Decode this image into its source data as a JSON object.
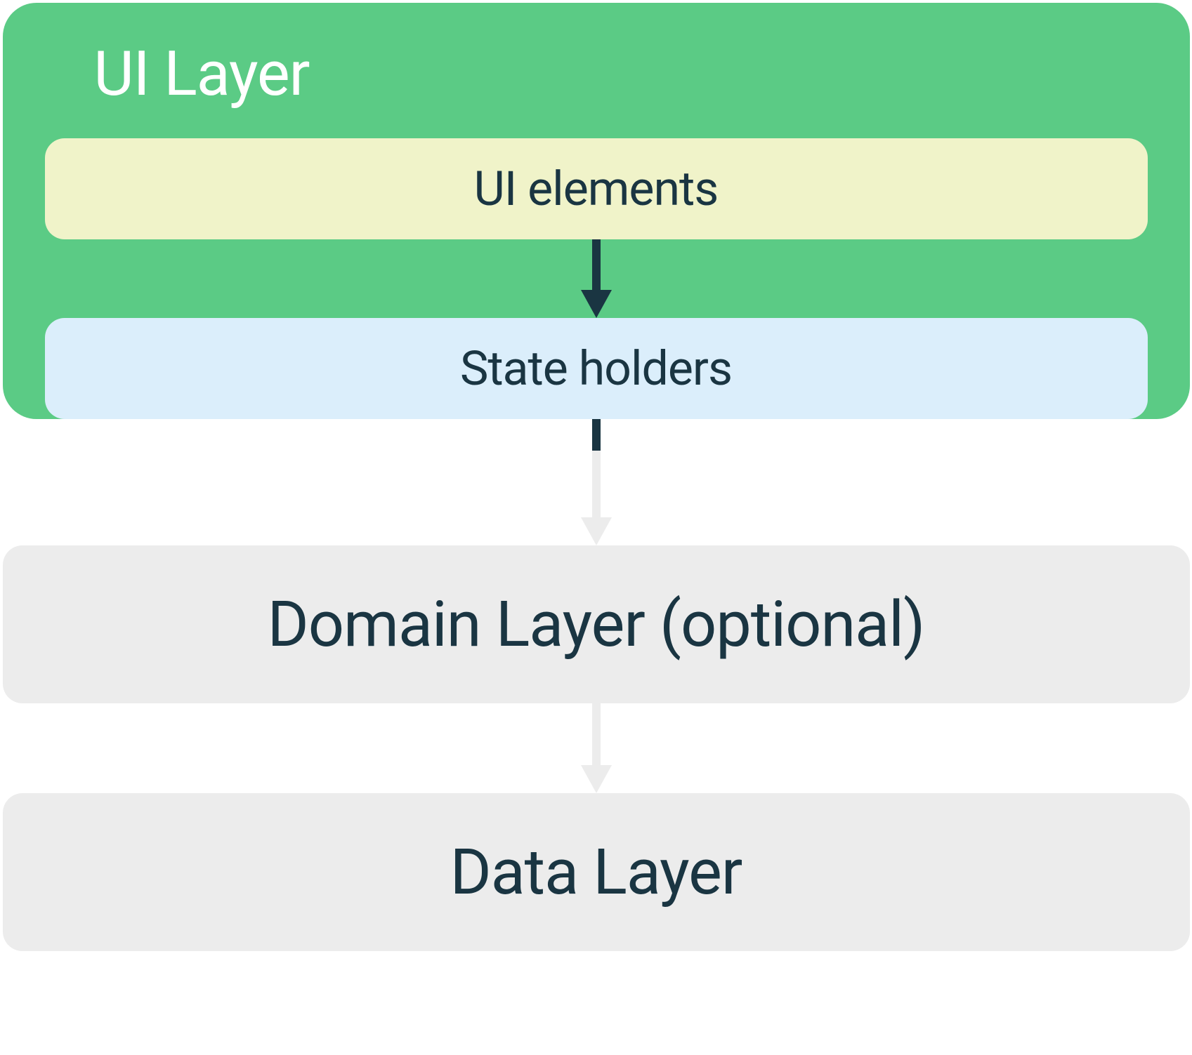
{
  "diagram": {
    "ui_layer": {
      "title": "UI Layer",
      "ui_elements_label": "UI elements",
      "state_holders_label": "State holders"
    },
    "domain_layer_label": "Domain Layer (optional)",
    "data_layer_label": "Data Layer"
  },
  "colors": {
    "ui_layer_bg": "#5bcb85",
    "ui_elements_bg": "#f0f3c9",
    "state_holders_bg": "#dbeefb",
    "layer_bg": "#ececec",
    "text_dark": "#1a3542",
    "text_white": "#ffffff",
    "arrow_dark": "#1a3542",
    "arrow_light": "#ececec"
  }
}
